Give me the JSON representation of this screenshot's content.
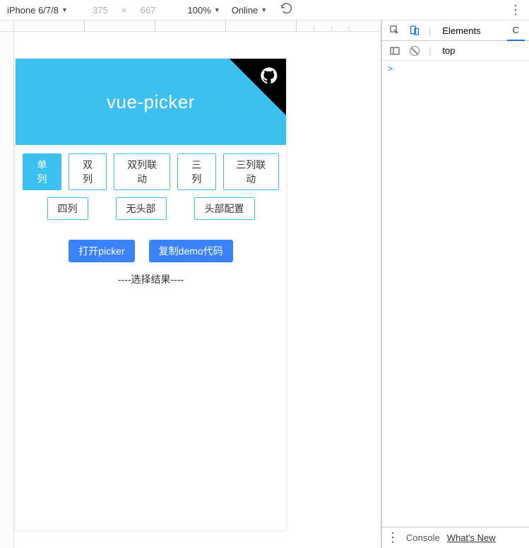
{
  "toolbar": {
    "device": "iPhone 6/7/8",
    "width": "375",
    "height": "667",
    "zoom": "100%",
    "network": "Online"
  },
  "app": {
    "title": "vue-picker",
    "options": [
      {
        "label": "单列",
        "active": true
      },
      {
        "label": "双列",
        "active": false
      },
      {
        "label": "双列联动",
        "active": false
      },
      {
        "label": "三列",
        "active": false
      },
      {
        "label": "三列联动",
        "active": false
      },
      {
        "label": "四列",
        "active": false
      },
      {
        "label": "无头部",
        "active": false
      },
      {
        "label": "头部配置",
        "active": false
      }
    ],
    "actions": {
      "open": "打开picker",
      "copy": "复制demo代码"
    },
    "result": "----选择结果----"
  },
  "devtools": {
    "tabs": {
      "elements": "Elements",
      "console_letter": "C"
    },
    "context": "top",
    "prompt": ">",
    "footer": {
      "console": "Console",
      "whatsnew": "What's New"
    }
  }
}
